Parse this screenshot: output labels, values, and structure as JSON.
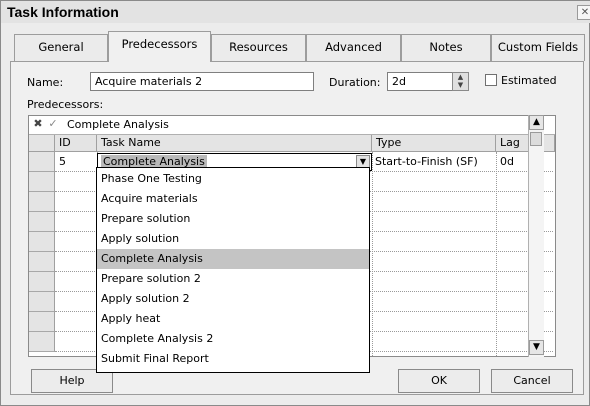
{
  "window": {
    "title": "Task Information",
    "close_glyph": "✕"
  },
  "tabs": [
    {
      "label": "General"
    },
    {
      "label": "Predecessors"
    },
    {
      "label": "Resources"
    },
    {
      "label": "Advanced"
    },
    {
      "label": "Notes"
    },
    {
      "label": "Custom Fields"
    }
  ],
  "form": {
    "name_label": "Name:",
    "name_value": "Acquire materials 2",
    "duration_label": "Duration:",
    "duration_value": "2d",
    "estimated_label": "Estimated",
    "predecessors_label": "Predecessors:"
  },
  "grid": {
    "edit_cancel_glyph": "✖",
    "edit_accept_glyph": "✓",
    "edit_value": "Complete Analysis",
    "columns": [
      "ID",
      "Task Name",
      "Type",
      "Lag"
    ],
    "row": {
      "id": "5",
      "task_name": "Complete Analysis",
      "type": "Start-to-Finish (SF)",
      "lag": "0d"
    }
  },
  "dropdown": {
    "options": [
      "Phase One Testing",
      "Acquire materials",
      "Prepare solution",
      "Apply solution",
      "Complete Analysis",
      "Prepare solution 2",
      "Apply solution 2",
      "Apply heat",
      "Complete Analysis 2",
      "Submit Final Report"
    ],
    "selected": "Complete Analysis"
  },
  "buttons": {
    "help": "Help",
    "ok": "OK",
    "cancel": "Cancel"
  },
  "icons": {
    "spin_up": "▲",
    "spin_down": "▼",
    "combo_arrow": "▼",
    "scroll_up": "▲",
    "scroll_down": "▼"
  }
}
